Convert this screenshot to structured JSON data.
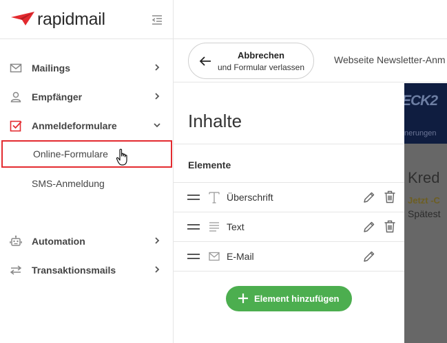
{
  "app": {
    "name": "rapidmail",
    "brand_color": "#e32a2f"
  },
  "sidebar": {
    "items": [
      {
        "label": "Mailings",
        "icon": "mail-icon"
      },
      {
        "label": "Empfänger",
        "icon": "user-icon"
      },
      {
        "label": "Anmeldeformulare",
        "icon": "checkbox-icon",
        "expanded": true
      },
      {
        "label": "Automation",
        "icon": "robot-icon"
      },
      {
        "label": "Transaktionsmails",
        "icon": "transfer-arrows-icon"
      }
    ],
    "subitems": [
      {
        "label": "Online-Formulare",
        "active": true
      },
      {
        "label": "SMS-Anmeldung"
      }
    ]
  },
  "topbar": {
    "cancel_line1": "Abbrechen",
    "cancel_line2": "und Formular verlassen",
    "form_name": "Webseite Newsletter-Anm"
  },
  "panel": {
    "title": "Inhalte",
    "elements_heading": "Elemente",
    "elements": [
      {
        "label": "Überschrift",
        "icon": "text-type-icon",
        "deletable": true
      },
      {
        "label": "Text",
        "icon": "paragraph-lines-icon",
        "deletable": true
      },
      {
        "label": "E-Mail",
        "icon": "envelope-icon",
        "deletable": false
      }
    ],
    "add_button": "Element hinzufügen",
    "add_button_color": "#4cae4f"
  },
  "preview": {
    "brand_partial": "ECK2",
    "nav_partial": "nerungen",
    "heading_partial": "Kred",
    "highlight_partial": "Jetzt -C",
    "text_partial": "Spätest"
  }
}
